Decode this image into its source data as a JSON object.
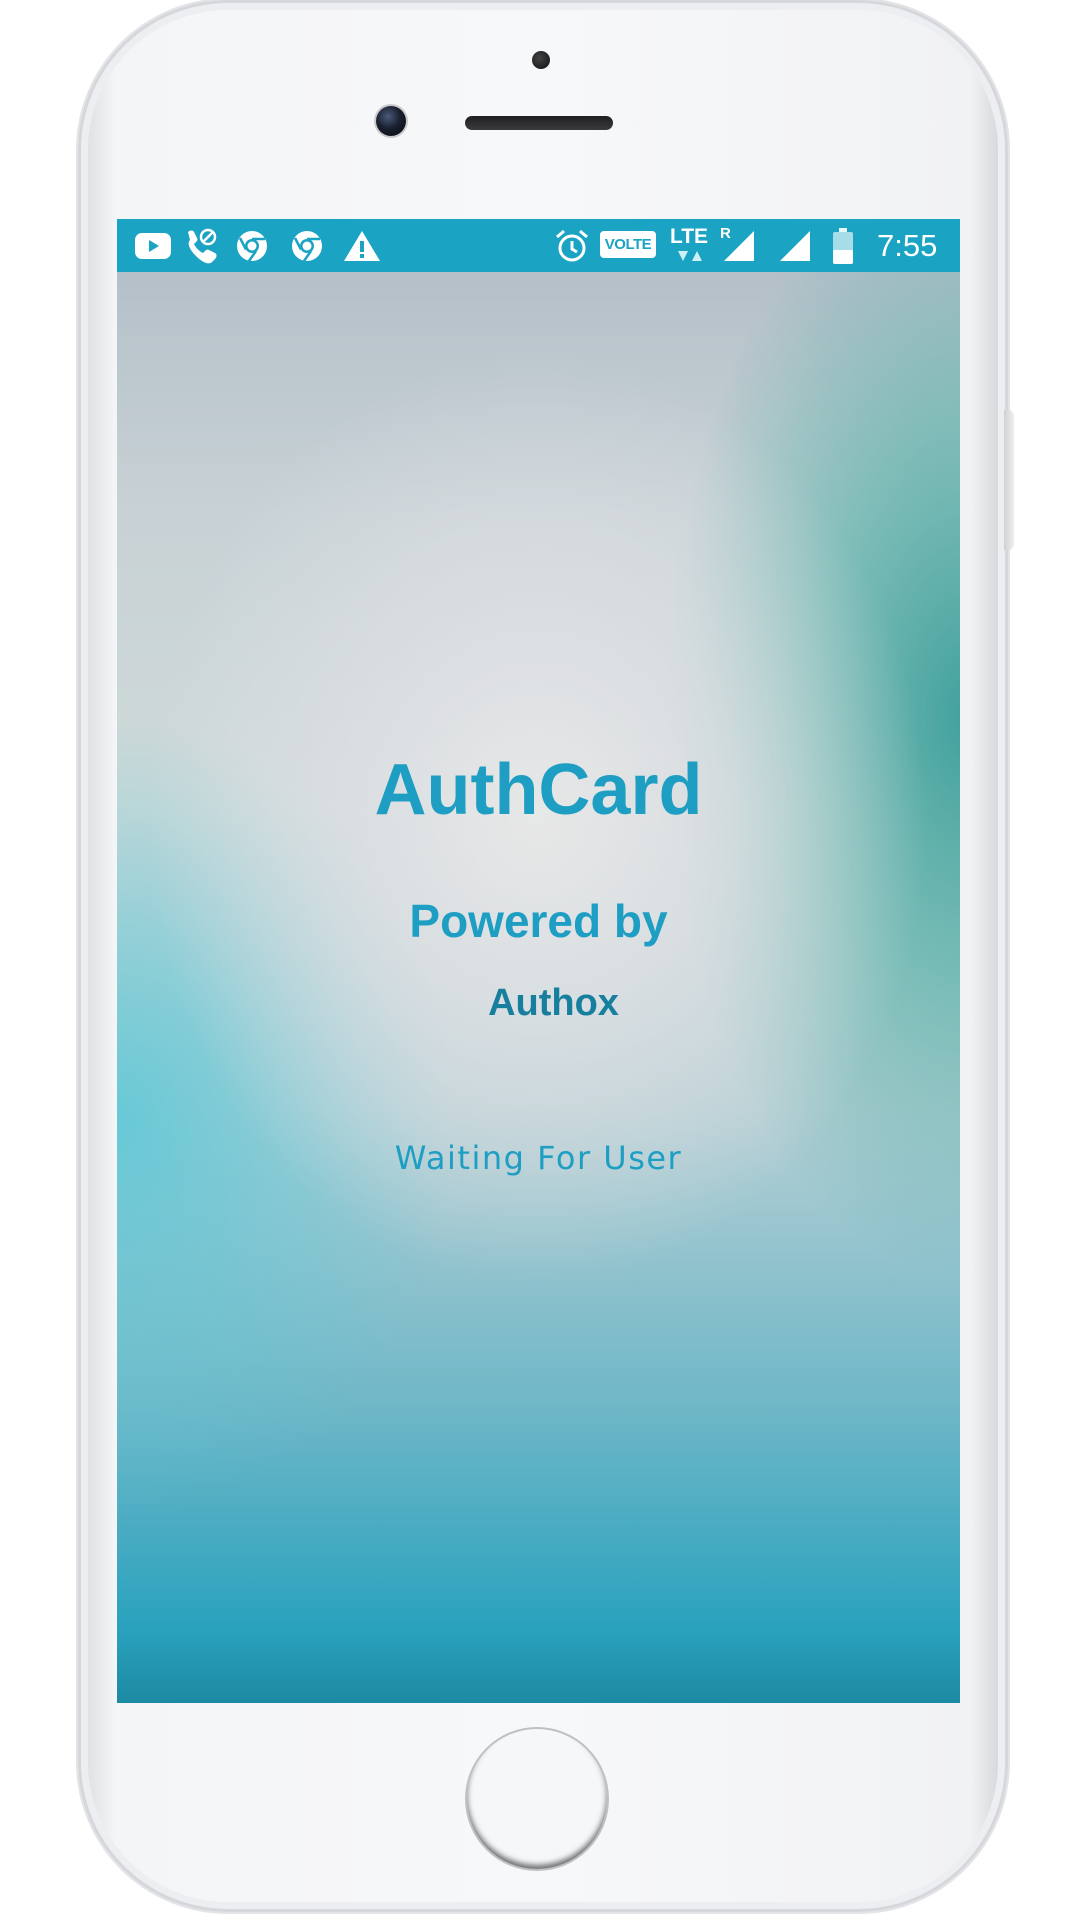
{
  "status_bar": {
    "left_icons": [
      "youtube-icon",
      "wifi-calling-icon",
      "chrome-icon",
      "chrome-icon",
      "warning-icon"
    ],
    "right_icons": [
      "alarm-icon",
      "volte-icon",
      "lte-icon",
      "signal-icon",
      "signal-icon",
      "battery-icon"
    ],
    "volte_label": "VOLTE",
    "lte_label": "LTE",
    "roaming_label": "R",
    "time": "7:55"
  },
  "splash": {
    "title": "AuthCard",
    "powered_by": "Powered by",
    "brand": "Authox",
    "status": "Waiting For User"
  },
  "colors": {
    "status_bar": "#1aa3c3",
    "title_text": "#1e9ec2",
    "brand_text": "#177f9e"
  }
}
